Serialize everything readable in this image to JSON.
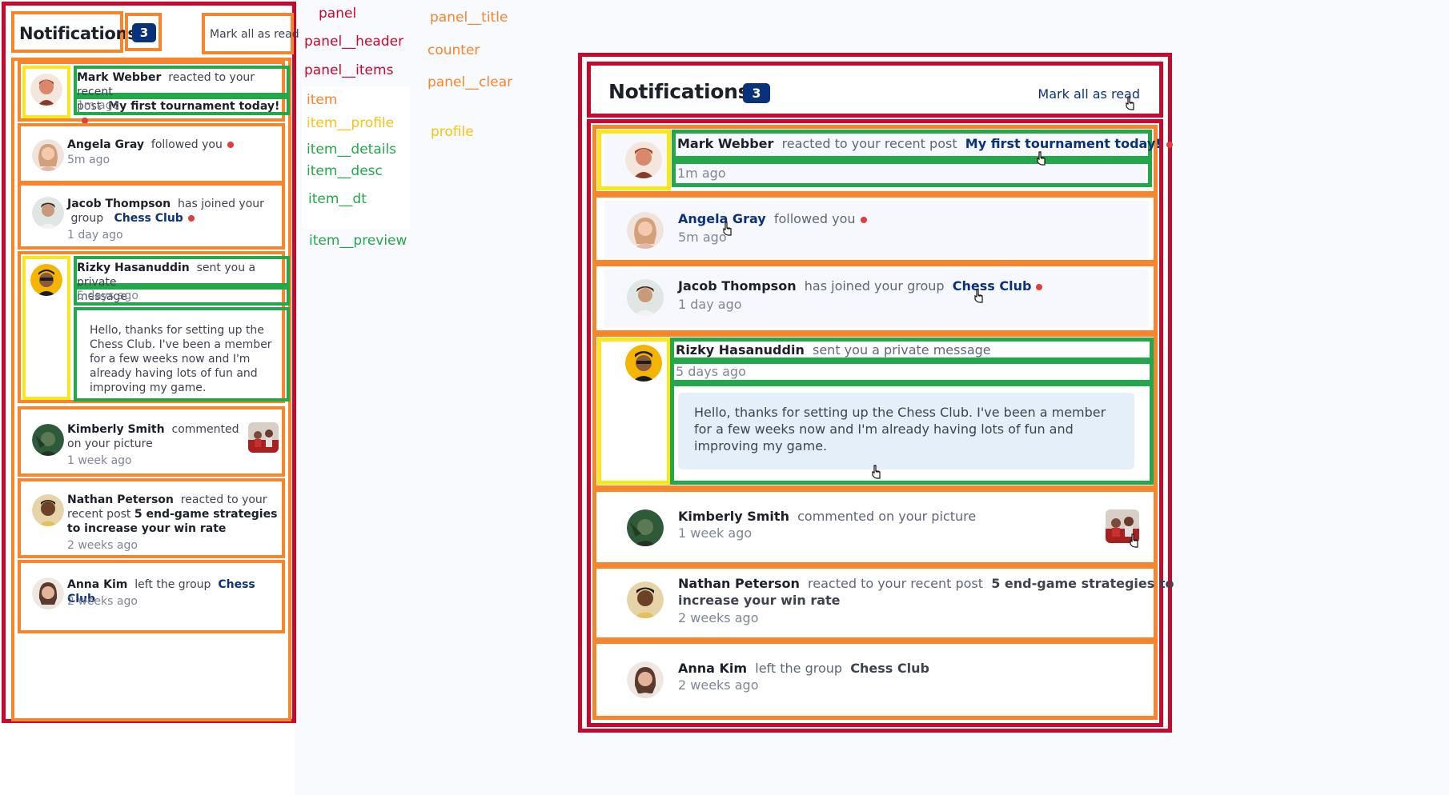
{
  "panel": {
    "title": "Notifications",
    "counter": "3",
    "clear_label": "Mark all as read"
  },
  "legend": {
    "panel": "panel",
    "panel_header": "panel__header",
    "panel_items": "panel__items",
    "item": "item",
    "item_profile": "item__profile",
    "item_details": "item__details",
    "item_desc": "item__desc",
    "item_dt": "item__dt",
    "item_preview": "item__preview",
    "panel_title": "panel__title",
    "counter": "counter",
    "panel_clear": "panel__clear",
    "profile": "profile"
  },
  "notifications": [
    {
      "name": "Mark Webber",
      "action": "reacted to your recent post",
      "target": "My first tournament today!",
      "time": "1m ago",
      "unread": true
    },
    {
      "name": "Angela Gray",
      "action": "followed you",
      "target": "",
      "time": "5m ago",
      "unread": true
    },
    {
      "name": "Jacob Thompson",
      "action": "has joined your group",
      "target": "Chess Club",
      "time": "1 day ago",
      "unread": true
    },
    {
      "name": "Rizky Hasanuddin",
      "action": "sent you a private message",
      "target": "",
      "time": "5 days ago",
      "unread": false,
      "preview": "Hello, thanks for setting up the Chess Club. I've been a member for a few weeks now and I'm already having lots of fun and improving my game."
    },
    {
      "name": "Kimberly Smith",
      "action": "commented on your picture",
      "target": "",
      "time": "1 week ago",
      "unread": false
    },
    {
      "name": "Nathan Peterson",
      "action": "reacted to your recent post",
      "target": "5 end-game strategies to increase your win rate",
      "time": "2 weeks ago",
      "unread": false
    },
    {
      "name": "Anna Kim",
      "action": "left the group",
      "target": "Chess Club",
      "time": "2 weeks ago",
      "unread": false
    }
  ],
  "small_text": {
    "n0_action_a": "reacted to your recent",
    "n0_action_b": "post",
    "n2_action_a": "has joined your",
    "n2_action_b": "group",
    "n3_action_a": "sent you a private",
    "n3_action_b": "message",
    "n3_preview": "Hello, thanks for setting up the Chess Club. I've been a member for a few weeks now and I'm already having lots of fun and improving my game.",
    "n4_action_a": "commented",
    "n4_action_b": "on your picture",
    "n5_action_a": "reacted to your",
    "n5_action_b": "recent post",
    "n5_target": "5 end-game strategies to increase your win rate"
  },
  "colors": {
    "panel_border": "#c9082d",
    "item_border": "#f8842b",
    "profile_border": "#f8e71c",
    "details_border": "#22a84a",
    "counter_bg": "#0a327b",
    "unread_dot": "#e43b3b",
    "unread_bg": "#f6f8fd",
    "preview_bg": "#e5effa"
  },
  "icons": [
    "avatar",
    "picture-thumbnail",
    "hand-pointer-cursor"
  ]
}
